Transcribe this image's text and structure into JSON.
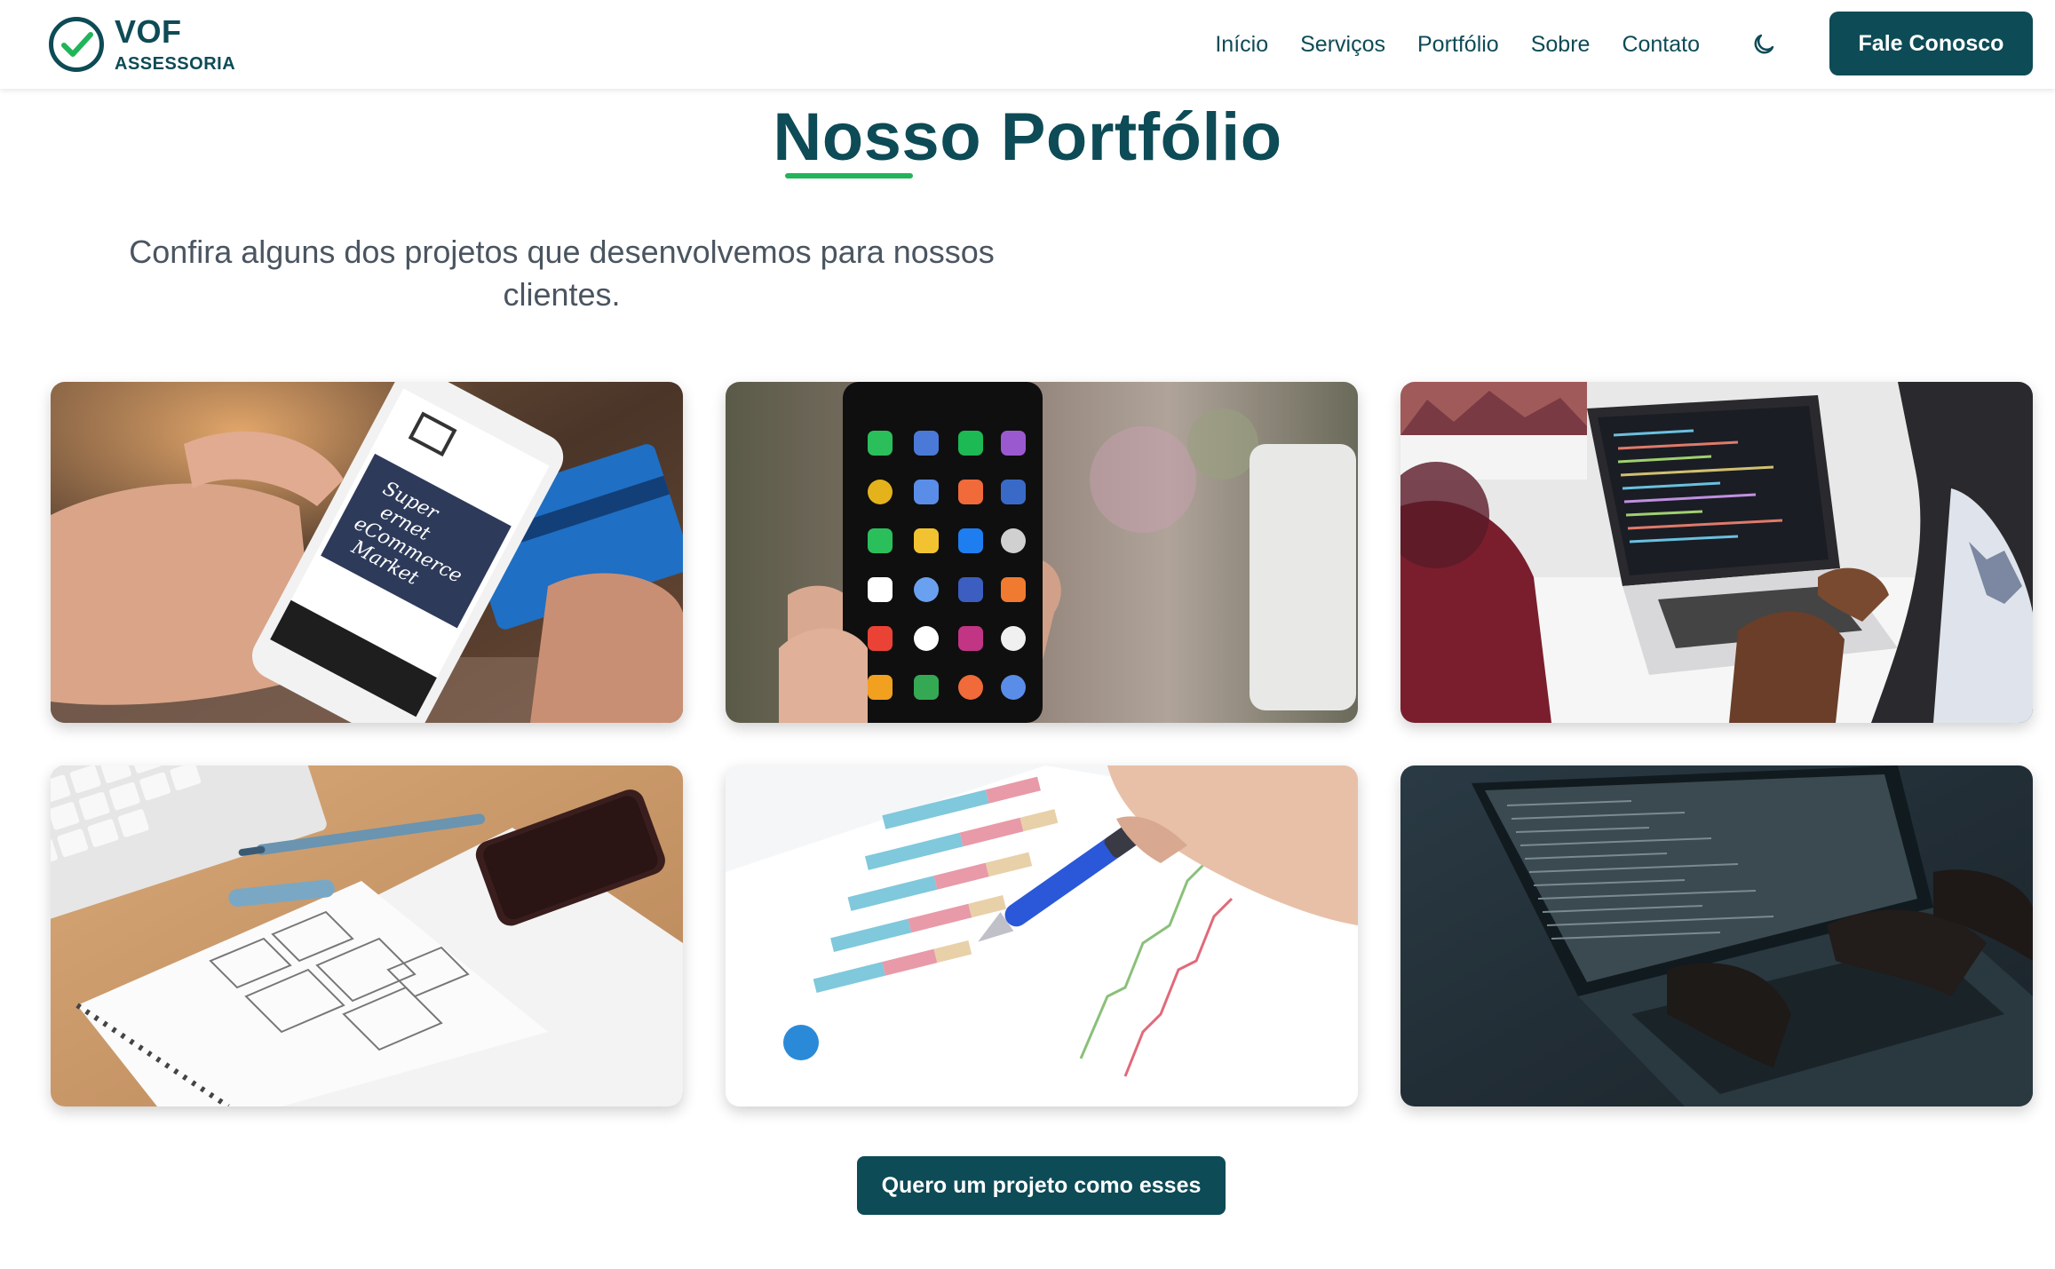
{
  "brand": {
    "name": "VOF",
    "subtitle": "ASSESSORIA",
    "primary_color": "#0d4b56",
    "accent_color": "#22b45a"
  },
  "nav": {
    "items": [
      {
        "label": "Início"
      },
      {
        "label": "Serviços"
      },
      {
        "label": "Portfólio"
      },
      {
        "label": "Sobre"
      },
      {
        "label": "Contato"
      }
    ],
    "theme_icon": "moon-icon",
    "cta_label": "Fale Conosco"
  },
  "section": {
    "title": "Nosso Portfólio",
    "subtitle": "Confira alguns dos projetos que desenvolvemos para nossos clientes.",
    "cta_label": "Quero um projeto como esses"
  },
  "portfolio": {
    "items": [
      {
        "image": "smartphone-ecommerce-photo",
        "screen_text": [
          "Super",
          "ernet",
          "eCommerce",
          "Market"
        ]
      },
      {
        "image": "android-phone-apps-photo"
      },
      {
        "image": "laptop-code-desk-photo"
      },
      {
        "image": "wireframe-sketch-notebook-photo"
      },
      {
        "image": "business-charts-pen-photo"
      },
      {
        "image": "dark-laptop-typing-photo"
      }
    ]
  }
}
